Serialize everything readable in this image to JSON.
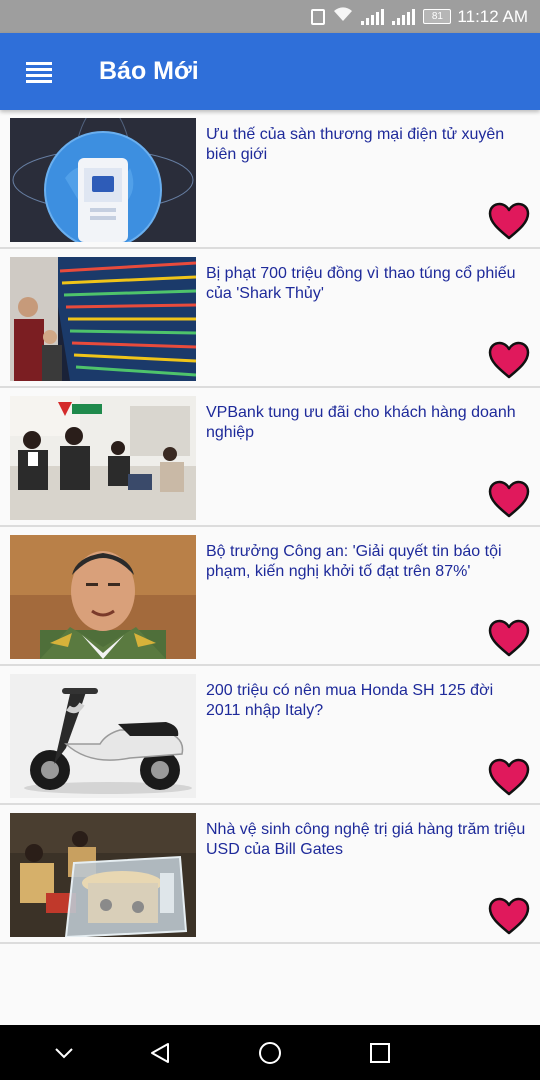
{
  "status_bar": {
    "battery": "81",
    "time": "11:12 AM",
    "icons": [
      "vibrate-icon",
      "wifi-icon",
      "signal-icon",
      "signal-icon",
      "battery-icon"
    ]
  },
  "app_bar": {
    "title": "Báo Mới",
    "menu_icon": "hamburger-menu-icon",
    "color": "#2f6fd9"
  },
  "articles": [
    {
      "title": "Ưu thế của sàn thương mại điện tử xuyên biên giới",
      "thumbnail": "globe-phone-illustration",
      "favorite_icon": "heart-icon"
    },
    {
      "title": "Bị phạt 700 triệu đồng vì thao túng cổ phiếu của 'Shark Thủy'",
      "thumbnail": "stock-board-photo",
      "favorite_icon": "heart-icon"
    },
    {
      "title": "VPBank tung ưu đãi cho khách hàng doanh nghiệp",
      "thumbnail": "bank-counter-photo",
      "favorite_icon": "heart-icon"
    },
    {
      "title": "Bộ trưởng Công an: 'Giải quyết tin báo tội phạm, kiến nghị khởi tố đạt trên 87%'",
      "thumbnail": "official-portrait-photo",
      "favorite_icon": "heart-icon"
    },
    {
      "title": "200 triệu có nên mua Honda SH 125 đời 2011 nhập Italy?",
      "thumbnail": "scooter-photo",
      "favorite_icon": "heart-icon"
    },
    {
      "title": "Nhà vệ sinh công nghệ trị giá hàng trăm triệu USD của Bill Gates",
      "thumbnail": "toilet-exhibit-photo",
      "favorite_icon": "heart-icon"
    }
  ],
  "colors": {
    "headline": "#1e2a9a",
    "heart_fill": "#e0195c",
    "heart_stroke": "#111111"
  },
  "nav_bar": {
    "buttons": [
      "collapse-icon",
      "back-icon",
      "home-icon",
      "recents-icon"
    ]
  }
}
